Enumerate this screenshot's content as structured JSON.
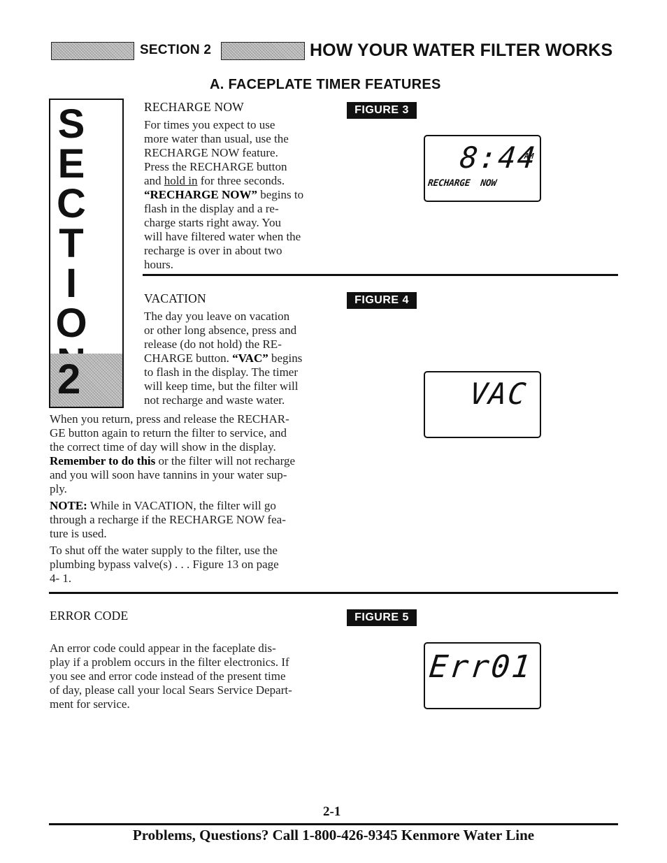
{
  "header": {
    "section_label": "SECTION 2",
    "title": "HOW YOUR WATER FILTER WORKS"
  },
  "subtitle": "A.  FACEPLATE TIMER FEATURES",
  "side_tab": {
    "letters": [
      "S",
      "E",
      "C",
      "T",
      "I",
      "O",
      "N"
    ],
    "number": "2"
  },
  "recharge_now": {
    "heading": "RECHARGE NOW",
    "lines": [
      "For times you expect to use",
      "more water than usual, use the",
      "RECHARGE NOW feature.",
      "Press the RECHARGE button"
    ],
    "line5_pre": "and ",
    "line5_underline": "hold in",
    "line5_post": " for three seconds.",
    "line6_bold": "“RECHARGE NOW”",
    "line6_post": " begins to",
    "lines_rest": [
      "flash in the display and a re-",
      "charge starts right away. You",
      "will have filtered water when the",
      "recharge is over in about two",
      "hours."
    ]
  },
  "vacation": {
    "heading": "VACATION",
    "lines": [
      "The day you leave on vacation",
      "or other long absence, press and",
      "release (do not hold) the RE-"
    ],
    "line4_pre": "CHARGE button. ",
    "line4_bold": "“VAC”",
    "line4_post": " begins",
    "lines_rest": [
      "to flash in the display. The timer",
      "will keep time, but the filter will",
      "not recharge and waste water."
    ],
    "return_lines": [
      "When you return, press and release the RECHAR-",
      "GE  button again to return the filter to service, and",
      "the correct time of day will show in the display."
    ],
    "remember_bold": "Remember to do this",
    "remember_post": " or the filter will not recharge",
    "remember_rest": [
      "and you will soon have tannins in your water sup-",
      "ply."
    ],
    "note_bold": "NOTE:",
    "note_post": " While in VACATION, the filter will go",
    "note_rest": [
      "through a recharge if the RECHARGE NOW fea-",
      "ture is used."
    ],
    "shutoff_lines": [
      "To shut off the water supply to the filter, use the",
      "plumbing bypass valve(s) . . . Figure 13 on page",
      "4- 1."
    ]
  },
  "error_code": {
    "heading": "ERROR CODE",
    "lines": [
      "An error code could appear in the faceplate dis-",
      "play if a problem occurs in the filter electronics. If",
      "you see and error code instead of the present time",
      "of day, please call your local Sears Service Depart-",
      "ment for service."
    ]
  },
  "figures": {
    "fig3": {
      "label": "FIGURE 3",
      "display_time": "8:44",
      "display_ampm": "AM",
      "display_status": "RECHARGE  NOW"
    },
    "fig4": {
      "label": "FIGURE 4",
      "display_text": "VAC"
    },
    "fig5": {
      "label": "FIGURE 5",
      "display_text": "Err01"
    }
  },
  "page_number": "2-1",
  "footer": "Problems, Questions? Call 1-800-426-9345 Kenmore Water Line"
}
